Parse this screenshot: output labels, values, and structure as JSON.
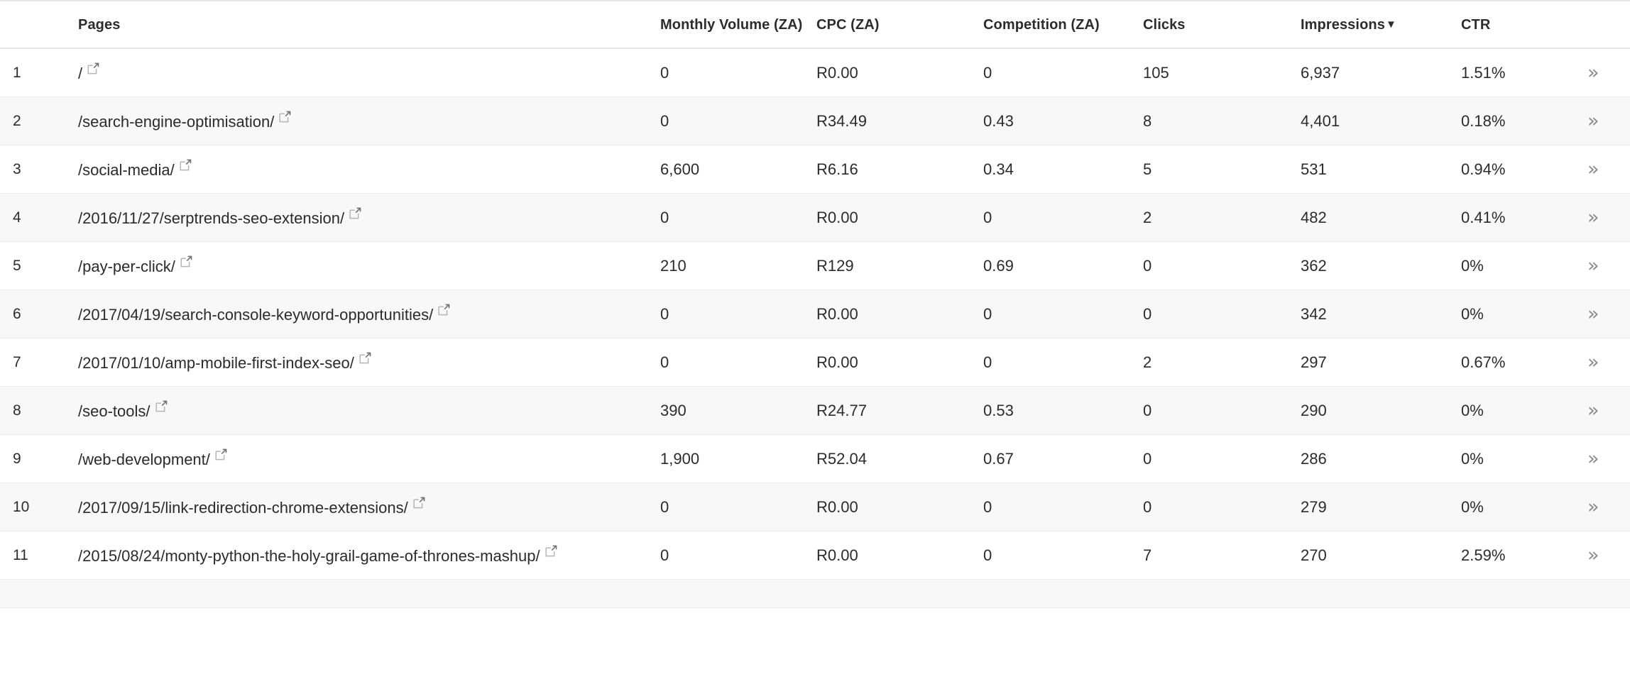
{
  "table": {
    "columns": [
      {
        "key": "rank",
        "label": ""
      },
      {
        "key": "pages",
        "label": "Pages"
      },
      {
        "key": "volume",
        "label": "Monthly Volume (ZA)"
      },
      {
        "key": "cpc",
        "label": "CPC (ZA)"
      },
      {
        "key": "competition",
        "label": "Competition (ZA)"
      },
      {
        "key": "clicks",
        "label": "Clicks"
      },
      {
        "key": "impressions",
        "label": "Impressions"
      },
      {
        "key": "ctr",
        "label": "CTR"
      }
    ],
    "sorted_column": "Impressions",
    "sort_direction_glyph": "▼",
    "expand_row_glyph": "»",
    "external_link_icon": "external-link-icon",
    "rows": [
      {
        "rank": "1",
        "page": "/",
        "volume": "0",
        "cpc": "R0.00",
        "competition": "0",
        "clicks": "105",
        "impressions": "6,937",
        "ctr": "1.51%"
      },
      {
        "rank": "2",
        "page": "/search-engine-optimisation/",
        "volume": "0",
        "cpc": "R34.49",
        "competition": "0.43",
        "clicks": "8",
        "impressions": "4,401",
        "ctr": "0.18%"
      },
      {
        "rank": "3",
        "page": "/social-media/",
        "volume": "6,600",
        "cpc": "R6.16",
        "competition": "0.34",
        "clicks": "5",
        "impressions": "531",
        "ctr": "0.94%"
      },
      {
        "rank": "4",
        "page": "/2016/11/27/serptrends-seo-extension/",
        "volume": "0",
        "cpc": "R0.00",
        "competition": "0",
        "clicks": "2",
        "impressions": "482",
        "ctr": "0.41%"
      },
      {
        "rank": "5",
        "page": "/pay-per-click/",
        "volume": "210",
        "cpc": "R129",
        "competition": "0.69",
        "clicks": "0",
        "impressions": "362",
        "ctr": "0%"
      },
      {
        "rank": "6",
        "page": "/2017/04/19/search-console-keyword-opportunities/",
        "volume": "0",
        "cpc": "R0.00",
        "competition": "0",
        "clicks": "0",
        "impressions": "342",
        "ctr": "0%"
      },
      {
        "rank": "7",
        "page": "/2017/01/10/amp-mobile-first-index-seo/",
        "volume": "0",
        "cpc": "R0.00",
        "competition": "0",
        "clicks": "2",
        "impressions": "297",
        "ctr": "0.67%"
      },
      {
        "rank": "8",
        "page": "/seo-tools/",
        "volume": "390",
        "cpc": "R24.77",
        "competition": "0.53",
        "clicks": "0",
        "impressions": "290",
        "ctr": "0%"
      },
      {
        "rank": "9",
        "page": "/web-development/",
        "volume": "1,900",
        "cpc": "R52.04",
        "competition": "0.67",
        "clicks": "0",
        "impressions": "286",
        "ctr": "0%"
      },
      {
        "rank": "10",
        "page": "/2017/09/15/link-redirection-chrome-extensions/",
        "volume": "0",
        "cpc": "R0.00",
        "competition": "0",
        "clicks": "0",
        "impressions": "279",
        "ctr": "0%"
      },
      {
        "rank": "11",
        "page": "/2015/08/24/monty-python-the-holy-grail-game-of-thrones-mashup/",
        "volume": "0",
        "cpc": "R0.00",
        "competition": "0",
        "clicks": "7",
        "impressions": "270",
        "ctr": "2.59%"
      }
    ]
  },
  "colors": {
    "text": "#2b2b2b",
    "header_text": "#2c2c2c",
    "row_alt_background": "#f8f8f8",
    "row_border": "#ececec",
    "header_border": "#e8e8e8",
    "icon_gray": "#8c8c8c"
  }
}
